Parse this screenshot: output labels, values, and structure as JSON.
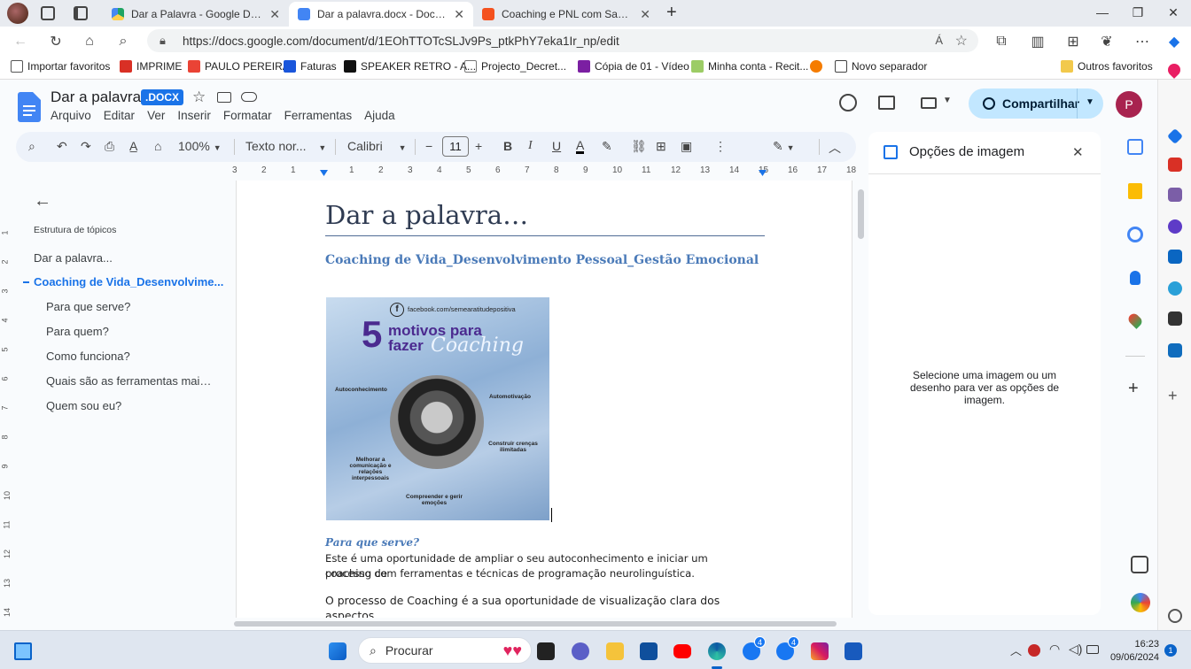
{
  "browser": {
    "tabs": [
      {
        "label": "Dar a Palavra - Google Drive",
        "color": "#1fa463"
      },
      {
        "label": "Dar a palavra.docx - Documento",
        "color": "#4285f4"
      },
      {
        "label": "Coaching e PNL com Sandra Pere",
        "color": "#f4511e"
      }
    ],
    "url": "https://docs.google.com/document/d/1EOhTTOTcSLJv9Ps_ptkPhY7eka1Ir_np/edit",
    "read_aloud": "Á",
    "bookmarks": [
      {
        "label": "Importar favoritos",
        "color": "#555"
      },
      {
        "label": "IMPRIME",
        "color": "#d93025"
      },
      {
        "label": "PAULO PEREIRA",
        "color": "#ea4335"
      },
      {
        "label": "Faturas",
        "color": "#1a56db"
      },
      {
        "label": "SPEAKER RETRO - A...",
        "color": "#111"
      },
      {
        "label": "Projecto_Decret...",
        "color": "#777"
      },
      {
        "label": "Cópia de 01 - Vídeo",
        "color": "#7b1fa2"
      },
      {
        "label": "Minha conta - Recit...",
        "color": "#9ccc65"
      },
      {
        "label": "",
        "color": "#f57c00"
      },
      {
        "label": "Novo separador",
        "color": "#444"
      },
      {
        "label": "Outros favoritos",
        "color": "#f2c94c"
      }
    ]
  },
  "docs": {
    "title": "Dar a palavra",
    "badge": ".DOCX",
    "menus": [
      "Arquivo",
      "Editar",
      "Ver",
      "Inserir",
      "Formatar",
      "Ferramentas",
      "Ajuda"
    ],
    "share_label": "Compartilhar",
    "avatar_letter": "P",
    "toolbar": {
      "zoom": "100%",
      "style": "Texto nor...",
      "font": "Calibri",
      "font_size": "11"
    },
    "ruler_numbers": [
      "3",
      "2",
      "1",
      "",
      "1",
      "2",
      "3",
      "4",
      "5",
      "6",
      "7",
      "8",
      "9",
      "10",
      "11",
      "12",
      "13",
      "14",
      "15",
      "16",
      "17",
      "18"
    ],
    "vruler_numbers": [
      "1",
      "2",
      "3",
      "4",
      "5",
      "6",
      "7",
      "8",
      "9",
      "10",
      "11",
      "12",
      "13",
      "14"
    ]
  },
  "outline": {
    "heading": "Estrutura de tópicos",
    "items": [
      {
        "label": "Dar a palavra...",
        "level": 0
      },
      {
        "label": "Coaching de Vida_Desenvolvime...",
        "level": 1,
        "active": true
      },
      {
        "label": "Para que serve?",
        "level": 2
      },
      {
        "label": "Para quem?",
        "level": 2
      },
      {
        "label": "Como funciona?",
        "level": 2
      },
      {
        "label": "Quais são as ferramentas mais ...",
        "level": 2
      },
      {
        "label": "Quem sou eu?",
        "level": 2
      }
    ]
  },
  "document": {
    "heading": "Dar a palavra…",
    "subtitle": "Coaching de Vida_Desenvolvimento Pessoal_Gestão Emocional",
    "image": {
      "facebook": "facebook.com/semearatitudepositiva",
      "big_number": "5",
      "title_line1": "motivos para",
      "title_line2": "fazer",
      "script_word": "Coaching",
      "labels": [
        "Autoconhecimento",
        "Automotivação",
        "Construir crenças ilimitadas",
        "Melhorar a comunicação e relações interpessoais",
        "Compreender e gerir emoções"
      ]
    },
    "section1_title": "Para que serve?",
    "section1_text1": "Este é uma oportunidade de ampliar o seu autoconhecimento e iniciar um processo de",
    "section1_text2": "coaching com ferramentas e técnicas de programação neurolinguística.",
    "section2_text1": "O processo de Coaching é a sua oportunidade de visualização clara dos aspectos"
  },
  "image_panel": {
    "title": "Opções de imagem",
    "message": "Selecione uma imagem ou um desenho para ver as opções de imagem."
  },
  "taskbar": {
    "search_placeholder": "Procurar",
    "time": "16:23",
    "date": "09/06/2024",
    "notification_count": "1",
    "badge1": "4",
    "badge2": "4"
  }
}
